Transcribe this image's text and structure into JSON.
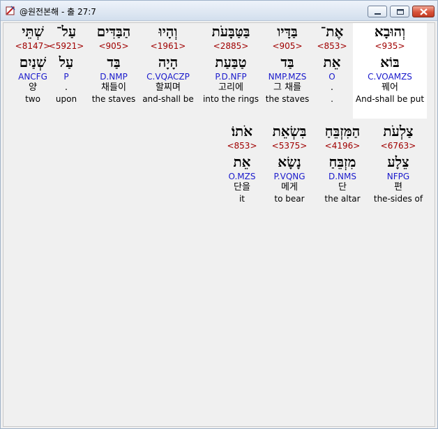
{
  "window": {
    "title": "@원전본해 - 출 27:7",
    "controls": [
      "minimize-icon",
      "maximize-icon",
      "close-icon"
    ]
  },
  "rows": [
    {
      "words": [
        {
          "hebrew": "שְׁתֵּי",
          "strong": "<8147>",
          "lemma": "שְׁנַיִם",
          "morph": "ANCFG",
          "korean": "양",
          "english": "two"
        },
        {
          "hebrew": "עַל־",
          "strong": "<5921>",
          "lemma": "עַל",
          "morph": "P",
          "korean": ".",
          "english": "upon"
        },
        {
          "hebrew": "הַבַּדִּים",
          "strong": "<905>",
          "lemma": "בַּד",
          "morph": "D.NMP",
          "korean": "채들이",
          "english": "the staves"
        },
        {
          "hebrew": "וְהָיוּ",
          "strong": "<1961>",
          "lemma": "הָיָה",
          "morph": "C.VQACZP",
          "korean": "할찌며",
          "english": "and-shall be"
        },
        {
          "hebrew": "בַּטַּבָּעֹת",
          "strong": "<2885>",
          "lemma": "טַבַּעַת",
          "morph": "P.D.NFP",
          "korean": "고리에",
          "english": "into the rings"
        },
        {
          "hebrew": "בַּדָּיו",
          "strong": "<905>",
          "lemma": "בַּד",
          "morph": "NMP.MZS",
          "korean": "그 채를",
          "english": "the staves"
        },
        {
          "hebrew": "אֶת־",
          "strong": "<853>",
          "lemma": "אֵת",
          "morph": "O",
          "korean": ".",
          "english": "."
        },
        {
          "hebrew": "וְהוּבָא",
          "strong": "<935>",
          "lemma": "בּוֹא",
          "morph": "C.VOAMZS",
          "korean": "꿰어",
          "english": "And-shall be put"
        }
      ]
    },
    {
      "words": [
        {
          "hebrew": "אֹתוֹ׃",
          "strong": "<853>",
          "lemma": "אֵת",
          "morph": "O.MZS",
          "korean": "단을",
          "english": "it"
        },
        {
          "hebrew": "בִּשְׂאֵת",
          "strong": "<5375>",
          "lemma": "נָשָׂא",
          "morph": "P.VQNG",
          "korean": "메게",
          "english": "to bear"
        },
        {
          "hebrew": "הַמִּזְבֵּחַ",
          "strong": "<4196>",
          "lemma": "מִזְבֵּחַ",
          "morph": "D.NMS",
          "korean": "단",
          "english": "the altar"
        },
        {
          "hebrew": "צַלְעֹת",
          "strong": "<6763>",
          "lemma": "צֵלָע",
          "morph": "NFPG",
          "korean": "편",
          "english": "the-sides of"
        }
      ]
    }
  ]
}
